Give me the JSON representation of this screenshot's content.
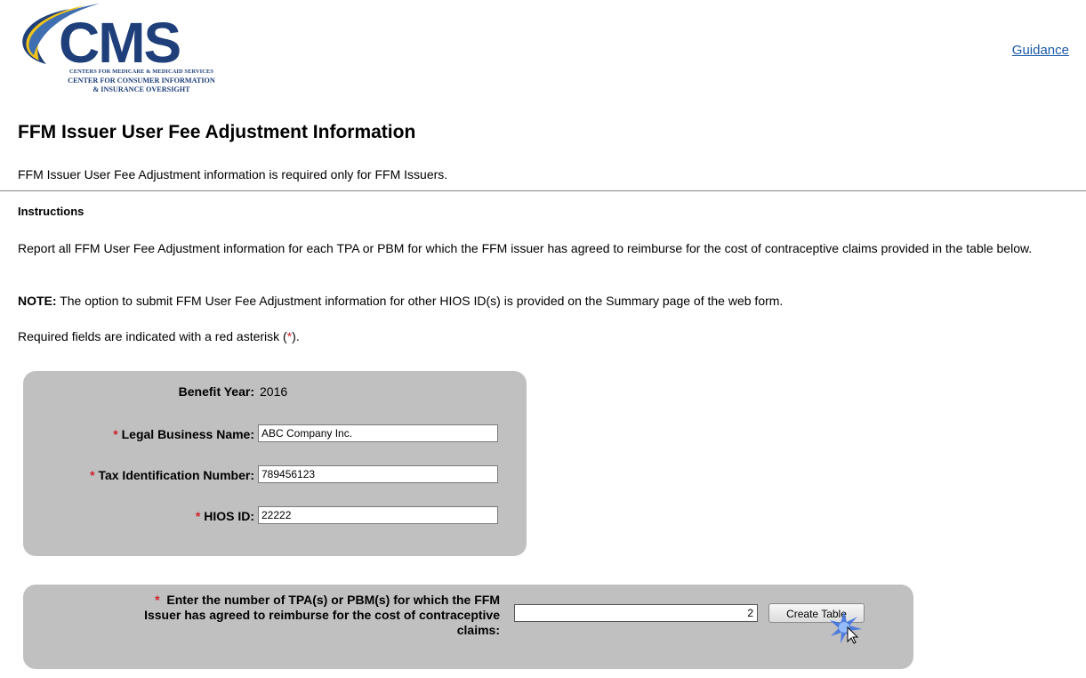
{
  "header": {
    "logo_text": "CMS",
    "logo_line1": "CENTERS FOR MEDICARE & MEDICAID SERVICES",
    "logo_line2": "CENTER FOR CONSUMER INFORMATION",
    "logo_line3": "& INSURANCE OVERSIGHT",
    "guidance_link": "Guidance"
  },
  "page": {
    "title": "FFM Issuer User Fee Adjustment Information",
    "intro": "FFM Issuer User Fee Adjustment information is required only for FFM Issuers.",
    "instructions_heading": "Instructions",
    "report_text": "Report all FFM User Fee Adjustment information for each TPA or PBM for which the FFM issuer has agreed to reimburse for the cost of contraceptive claims provided in the table below.",
    "note_label": "NOTE:",
    "note_text": " The option to submit FFM User Fee Adjustment information for other HIOS ID(s) is provided on the Summary page of the web form.",
    "required_prefix": "Required fields are indicated with a red asterisk (",
    "required_asterisk": "*",
    "required_suffix": ")."
  },
  "form": {
    "asterisk": "*",
    "benefit_year_label": "Benefit Year:",
    "benefit_year_value": "2016",
    "legal_name_label": "Legal Business Name:",
    "legal_name_value": "ABC Company Inc.",
    "tin_label": "Tax Identification Number:",
    "tin_value": "789456123",
    "hios_label": "HIOS ID:",
    "hios_value": "22222"
  },
  "tpa": {
    "question_line1": "Enter the number of TPA(s) or PBM(s) for which the FFM",
    "question_line2": "Issuer has agreed to reimburse for the cost of contraceptive",
    "question_line3": "claims:",
    "count_value": "2",
    "create_button": "Create Table"
  },
  "colors": {
    "brand_blue": "#1f3f7a",
    "brand_gold": "#f0c419",
    "link": "#1a5aa8",
    "required_red": "#d0202a",
    "panel_gray": "#c0c0c0"
  }
}
